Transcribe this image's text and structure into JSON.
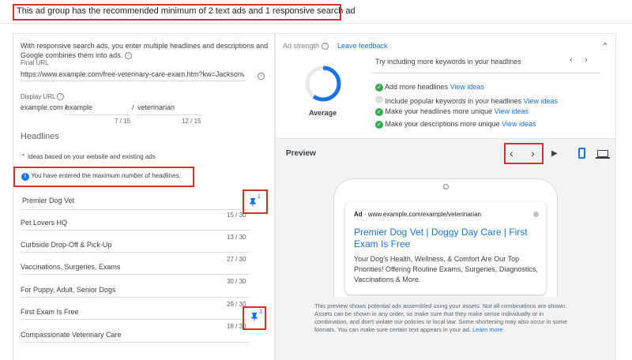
{
  "banner": {
    "message": "This ad group has the recommended minimum of 2 text ads and 1 responsive search ad"
  },
  "left": {
    "intro_line1": "With responsive search ads, you enter multiple headlines and descriptions and",
    "intro_line2": "Google combines them into ads.",
    "final_url_label": "Final URL",
    "final_url_value": "https://www.example.com/free-veterinary-care-exam.htm?kw=Jacksonville,+",
    "display_url_label": "Display URL",
    "display_domain": "example.com /",
    "path1": "example",
    "path_sep": "/",
    "path2": "veterinarian",
    "path1_count": "7 / 15",
    "path2_count": "12 / 15",
    "headlines_title": "Headlines",
    "ideas_label": "Ideas based on your website and existing ads",
    "max_notice": "You have entered the maximum number of headlines.",
    "headlines": [
      {
        "text": "Premier Dog Vet",
        "count": "15 / 30",
        "pin": "1"
      },
      {
        "text": "Pet Lovers HQ",
        "count": "13 / 30",
        "pin": ""
      },
      {
        "text": "Curbside Drop-Off & Pick-Up",
        "count": "27 / 30",
        "pin": ""
      },
      {
        "text": "Vaccinations, Surgeries, Exams",
        "count": "30 / 30",
        "pin": ""
      },
      {
        "text": "For Puppy, Adult, Senior Dogs",
        "count": "29 / 30",
        "pin": ""
      },
      {
        "text": "First Exam Is Free",
        "count": "18 / 30",
        "pin": "3"
      },
      {
        "text": "Compassionate Veterinary Care",
        "count": "",
        "pin": ""
      }
    ]
  },
  "strength": {
    "label": "Ad strength",
    "feedback_link": "Leave feedback",
    "rating": "Average",
    "progress": 0.6,
    "tip": "Try including more keywords in your headlines",
    "items": [
      {
        "text": "Add more headlines",
        "link": "View ideas",
        "done": true
      },
      {
        "text": "Include popular keywords in your headlines",
        "link": "View ideas",
        "done": false
      },
      {
        "text": "Make your headlines more unique",
        "link": "View ideas",
        "done": true
      },
      {
        "text": "Make your descriptions more unique",
        "link": "View ideas",
        "done": true
      }
    ]
  },
  "preview": {
    "title": "Preview",
    "ad_badge": "Ad",
    "ad_url": "www.example.com/example/veterinarian",
    "headline_line1": "Premier Dog Vet | Doggy Day Care | First",
    "headline_line2": "Exam Is Free",
    "desc_line1": "Your Dog's Health, Wellness, & Comfort Are Our Top",
    "desc_line2": "Priorities! Offering Routine Exams, Surgeries, Diagnostics,",
    "desc_line3": "Vaccinations & More.",
    "disclaimer_line1": "This preview shows potential ads assembled using your assets. Not all combinations are shown.",
    "disclaimer_line2": "Assets can be shown in any order, so make sure that they make sense individually or in",
    "disclaimer_line3": "combination, and don't violate our policies or local law. Some shortening may also occur in some",
    "disclaimer_line4": "formats. You can make sure certain text appears in your ad.",
    "learn_more": "Learn more"
  },
  "colors": {
    "accent": "#1a73e8",
    "highlight": "#d93025",
    "success": "#34a853",
    "ad_headline": "#1a0dab"
  }
}
